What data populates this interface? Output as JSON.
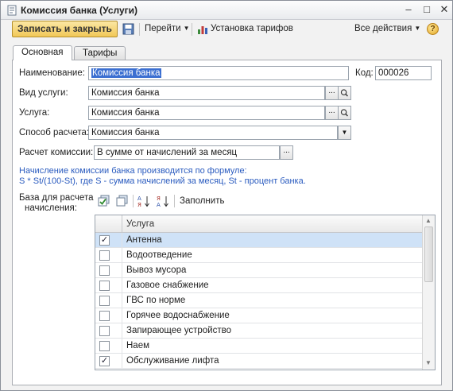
{
  "window": {
    "title": "Комиссия банка (Услуги)",
    "minimize": "–",
    "maximize": "□",
    "close": "✕"
  },
  "toolbar": {
    "save_close": "Записать и закрыть",
    "goto": "Перейти",
    "tariffs_setup": "Установка тарифов",
    "all_actions": "Все действия",
    "help": "?"
  },
  "tabs": [
    {
      "label": "Основная",
      "active": true
    },
    {
      "label": "Тарифы",
      "active": false
    }
  ],
  "form": {
    "name_label": "Наименование:",
    "name_value": "Комиссия банка",
    "code_label": "Код:",
    "code_value": "000026",
    "service_type_label": "Вид услуги:",
    "service_type_value": "Комиссия банка",
    "service_label": "Услуга:",
    "service_value": "Комиссия банка",
    "calc_method_label": "Способ расчета:",
    "calc_method_value": "Комиссия банка",
    "commission_calc_label": "Расчет комиссии:",
    "commission_calc_value": "В сумме от начислений за месяц",
    "note_line1": "Начисление комиссии банка производится по формуле:",
    "note_line2": "S * St/(100-St), где S - сумма начислений за месяц, St - процент банка.",
    "base_label_line1": "База для расчета",
    "base_label_line2": "начисления:",
    "fill_button": "Заполнить",
    "ellipsis": "..."
  },
  "table": {
    "column_header": "Услуга",
    "rows": [
      {
        "label": "Антенна",
        "checked": true,
        "selected": true
      },
      {
        "label": "Водоотведение",
        "checked": false,
        "selected": false
      },
      {
        "label": "Вывоз мусора",
        "checked": false,
        "selected": false
      },
      {
        "label": "Газовое снабжение",
        "checked": false,
        "selected": false
      },
      {
        "label": "ГВС по норме",
        "checked": false,
        "selected": false
      },
      {
        "label": "Горячее водоснабжение",
        "checked": false,
        "selected": false
      },
      {
        "label": "Запирающее устройство",
        "checked": false,
        "selected": false
      },
      {
        "label": "Наем",
        "checked": false,
        "selected": false
      },
      {
        "label": "Обслуживание лифта",
        "checked": true,
        "selected": false
      }
    ]
  },
  "colors": {
    "save_button": "#f1c858",
    "note_text": "#2a5bbf",
    "selection": "#3b6fd1",
    "selected_row": "#cfe2f7"
  }
}
